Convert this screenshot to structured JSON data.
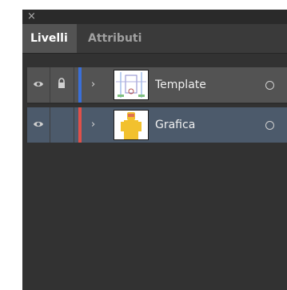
{
  "window": {
    "close_glyph": "×"
  },
  "tabs": [
    {
      "label": "Livelli",
      "active": true
    },
    {
      "label": "Attributi",
      "active": false
    }
  ],
  "layers": [
    {
      "name": "Template",
      "visible": true,
      "locked": true,
      "color": "#3a6fd8",
      "target_glyph": "○",
      "expand_glyph": "›"
    },
    {
      "name": "Grafica",
      "visible": true,
      "locked": false,
      "color": "#e0504a",
      "target_glyph": "○",
      "expand_glyph": "›",
      "selected": true
    }
  ],
  "icons": {
    "visibility": "eye-icon",
    "lock": "lock-icon",
    "expand": "chevron-right-icon",
    "target": "target-circle-icon"
  }
}
